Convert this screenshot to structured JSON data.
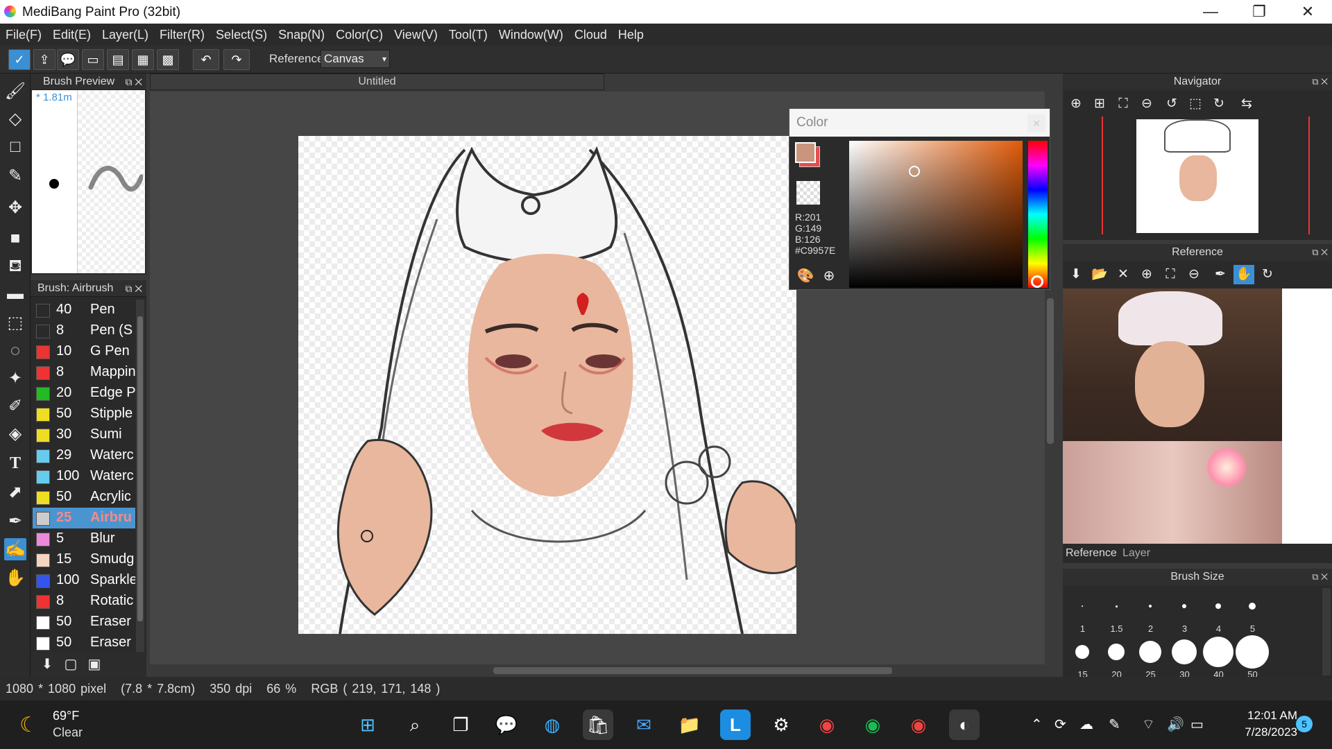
{
  "window": {
    "title": "MediBang Paint Pro (32bit)",
    "minimize": "—",
    "restore": "❐",
    "close": "✕"
  },
  "menu": [
    "File(F)",
    "Edit(E)",
    "Layer(L)",
    "Filter(R)",
    "Select(S)",
    "Snap(N)",
    "Color(C)",
    "View(V)",
    "Tool(T)",
    "Window(W)",
    "Cloud",
    "Help"
  ],
  "toolbar": {
    "reference_label": "Reference",
    "reference_value": "Canvas"
  },
  "brush_preview": {
    "title": "Brush Preview",
    "size_text": "* 1.81m"
  },
  "brush_panel": {
    "title": "Brush: Airbrush",
    "items": [
      {
        "size": "40",
        "name": "Pen",
        "color": "#2a2a2a"
      },
      {
        "size": "8",
        "name": "Pen (S",
        "color": "#2a2a2a"
      },
      {
        "size": "10",
        "name": "G Pen",
        "color": "#ee3333"
      },
      {
        "size": "8",
        "name": "Mappin",
        "color": "#ee3333"
      },
      {
        "size": "20",
        "name": "Edge P",
        "color": "#22bb22"
      },
      {
        "size": "50",
        "name": "Stipple",
        "color": "#eedd22"
      },
      {
        "size": "30",
        "name": "Sumi",
        "color": "#eedd22"
      },
      {
        "size": "29",
        "name": "Waterc",
        "color": "#66ccee"
      },
      {
        "size": "100",
        "name": "Waterc",
        "color": "#66ccee"
      },
      {
        "size": "50",
        "name": "Acrylic",
        "color": "#eedd22"
      },
      {
        "size": "25",
        "name": "Airbru",
        "color": "#cccccc"
      },
      {
        "size": "5",
        "name": "Blur",
        "color": "#ee88dd"
      },
      {
        "size": "15",
        "name": "Smudg",
        "color": "#f5d5c0"
      },
      {
        "size": "100",
        "name": "Sparkle",
        "color": "#3355ee"
      },
      {
        "size": "8",
        "name": "Rotatic",
        "color": "#ee3333"
      },
      {
        "size": "50",
        "name": "Eraser",
        "color": "#ffffff"
      },
      {
        "size": "50",
        "name": "Eraser",
        "color": "#ffffff"
      }
    ]
  },
  "document": {
    "tab_title": "Untitled"
  },
  "color_panel": {
    "title": "Color",
    "r": "R:201",
    "g": "G:149",
    "b": "B:126",
    "hex": "#C9957E",
    "foreground": "#C9957E",
    "background": "#e05050"
  },
  "navigator": {
    "title": "Navigator"
  },
  "reference": {
    "title": "Reference",
    "tabs": [
      "Reference",
      "Layer"
    ]
  },
  "brush_size": {
    "title": "Brush Size",
    "sizes": [
      "1",
      "1.5",
      "2",
      "3",
      "4",
      "5",
      "15",
      "20",
      "25",
      "30",
      "40",
      "50"
    ]
  },
  "status": {
    "dimensions": "1080 * 1080 pixel",
    "physical": "(7.8 * 7.8cm)",
    "dpi": "350 dpi",
    "zoom": "66 %",
    "rgb": "RGB ( 219, 171, 148 )"
  },
  "taskbar": {
    "weather_temp": "69°F",
    "weather_desc": "Clear",
    "time": "12:01 AM",
    "date": "7/28/2023",
    "notifications": "5"
  }
}
